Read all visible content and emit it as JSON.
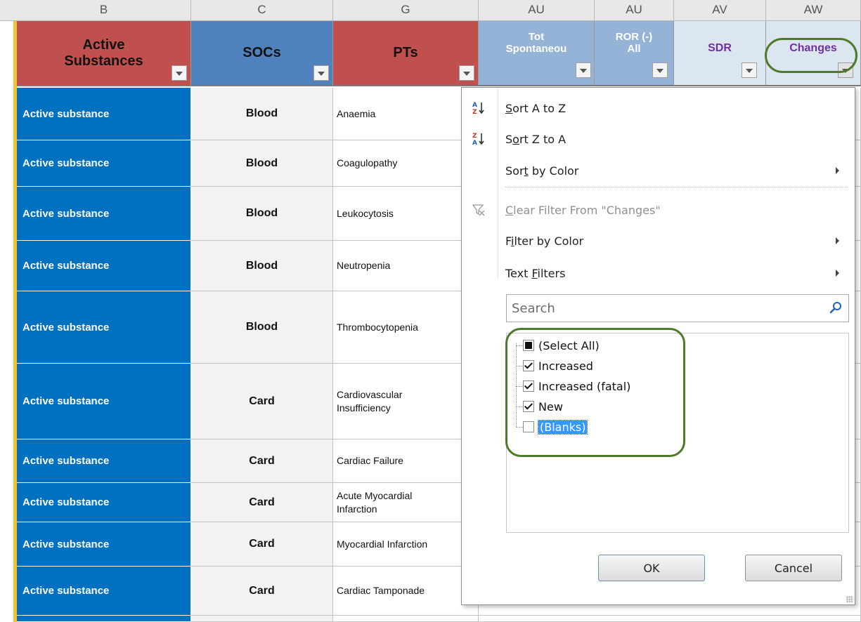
{
  "column_letters": [
    "B",
    "C",
    "G",
    "AU",
    "AU",
    "AV",
    "AW"
  ],
  "headers": [
    {
      "label": "Active\nSubstances",
      "bg": "#c0504d",
      "color": "#111111"
    },
    {
      "label": "SOCs",
      "bg": "#4f81bd",
      "color": "#111111"
    },
    {
      "label": "PTs",
      "bg": "#c0504d",
      "color": "#111111"
    },
    {
      "label": "Tot\nSpontaneou",
      "bg": "#95b3d7",
      "color": "#ffffff"
    },
    {
      "label": "ROR (-)\nAll",
      "bg": "#95b3d7",
      "color": "#ffffff"
    },
    {
      "label": "SDR",
      "bg": "#dce6f1",
      "color": "#7030a0"
    },
    {
      "label": "Changes",
      "bg": "#dce6f1",
      "color": "#7030a0"
    }
  ],
  "rows": [
    {
      "substance": "Active substance",
      "soc": "Blood",
      "pt": "Anaemia"
    },
    {
      "substance": "Active substance",
      "soc": "Blood",
      "pt": "Coagulopathy"
    },
    {
      "substance": "Active substance",
      "soc": "Blood",
      "pt": "Leukocytosis"
    },
    {
      "substance": "Active substance",
      "soc": "Blood",
      "pt": "Neutropenia"
    },
    {
      "substance": "Active substance",
      "soc": "Blood",
      "pt": "Thrombocytopenia"
    },
    {
      "substance": "Active substance",
      "soc": "Card",
      "pt": "Cardiovascular\nInsufficiency"
    },
    {
      "substance": "Active substance",
      "soc": "Card",
      "pt": "Cardiac Failure"
    },
    {
      "substance": "Active substance",
      "soc": "Card",
      "pt": "Acute Myocardial\nInfarction"
    },
    {
      "substance": "Active substance",
      "soc": "Card",
      "pt": "Myocardial Infarction"
    },
    {
      "substance": "Active substance",
      "soc": "Card",
      "pt": "Cardiac Tamponade"
    }
  ],
  "filter_menu": {
    "sort_a_z": {
      "pre": "",
      "accel": "S",
      "post": "ort A to Z"
    },
    "sort_z_a": {
      "pre": "S",
      "accel": "o",
      "post": "rt Z to A"
    },
    "sort_by_color": {
      "pre": "Sor",
      "accel": "t",
      "post": " by Color"
    },
    "clear_filter": {
      "pre": "",
      "accel": "C",
      "post": "lear Filter From \"Changes\""
    },
    "filter_by_color": {
      "pre": "F",
      "accel": "i",
      "post": "lter by Color"
    },
    "text_filters": {
      "pre": "Text ",
      "accel": "F",
      "post": "ilters"
    },
    "search_placeholder": "Search",
    "values": [
      {
        "label": "(Select All)",
        "state": "partial"
      },
      {
        "label": "Increased",
        "state": "checked"
      },
      {
        "label": "Increased (fatal)",
        "state": "checked"
      },
      {
        "label": "New",
        "state": "checked"
      },
      {
        "label": "(Blanks)",
        "state": "unchecked"
      }
    ],
    "ok_label": "OK",
    "cancel_label": "Cancel"
  },
  "colors": {
    "substance_cell": "#0070c0",
    "gutter_accent": "#f1c232",
    "highlight_ring": "#4e7b2a",
    "selection": "#3399ff"
  }
}
